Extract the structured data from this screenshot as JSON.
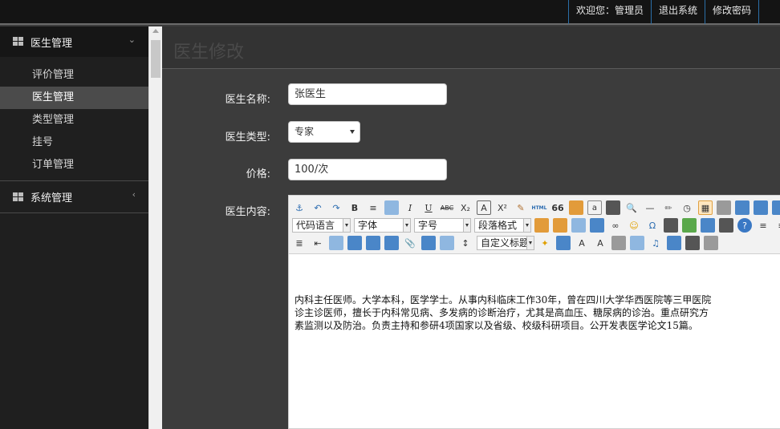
{
  "topbar": {
    "welcome": "欢迎您：管理员",
    "logout": "退出系统",
    "change_password": "修改密码"
  },
  "sidebar": {
    "sections": [
      {
        "label": "医生管理",
        "items": [
          "评价管理",
          "医生管理",
          "类型管理",
          "挂号",
          "订单管理"
        ],
        "active_item": "医生管理"
      },
      {
        "label": "系统管理"
      }
    ]
  },
  "page": {
    "title": "医生修改"
  },
  "form": {
    "name_label": "医生名称:",
    "name_value": "张医生",
    "type_label": "医生类型:",
    "type_value": "专家",
    "price_label": "价格:",
    "price_value": "100/次",
    "content_label": "医生内容:"
  },
  "editor": {
    "selects": [
      "代码语言",
      "字体",
      "字号",
      "段落格式",
      "自定义标题"
    ],
    "toolbar_text": {
      "html": "HTML",
      "quote": "66"
    },
    "content_lines": [
      "内科主任医师。大学本科，医学学士。从事内科临床工作30年，曾在四川大学华西医院等三甲医院",
      "诊主诊医师，擅长于内科常见病、多发病的诊断治疗，尤其是高血压、糖尿病的诊治。重点研究方",
      "素监测以及防治。负责主持和参研4项国家以及省级、校级科研项目。公开发表医学论文15篇。"
    ]
  },
  "colors": {
    "topbar_bg": "#141414",
    "sidebar_bg": "#1f1f1f",
    "main_bg": "#3c3c3c",
    "link_border": "#2b6fa8"
  }
}
